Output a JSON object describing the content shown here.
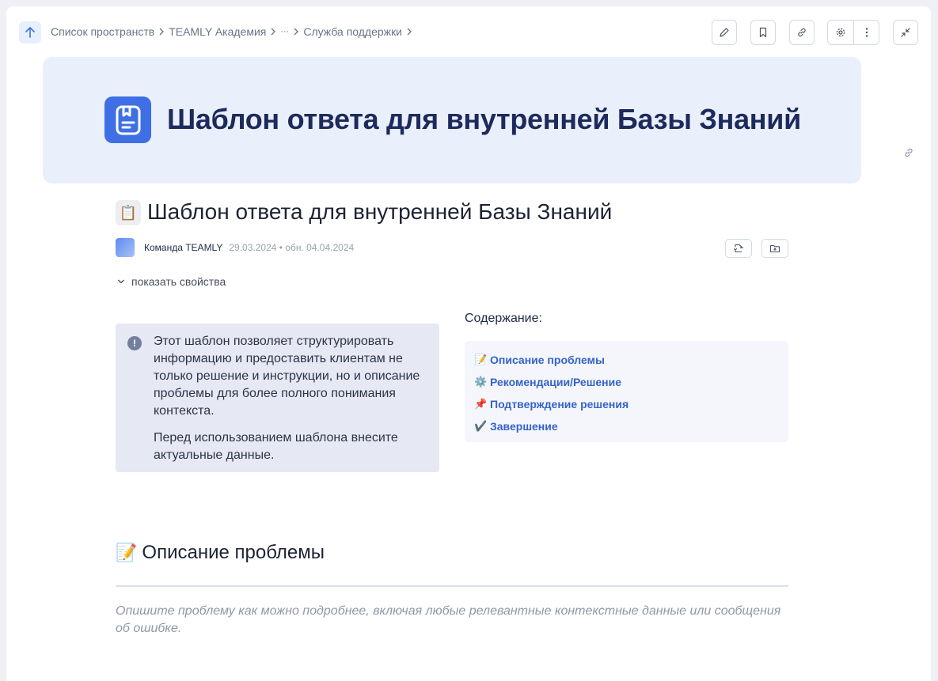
{
  "breadcrumb": {
    "items": [
      "Список пространств",
      "TEAMLY Академия",
      "···",
      "Служба поддержки"
    ]
  },
  "toolbar": {
    "buttons": [
      "pencil-icon",
      "bookmark-icon",
      "link-icon",
      "gear-icon",
      "more-vertical-icon",
      "collapse-icon"
    ]
  },
  "banner": {
    "title": "Шаблон ответа для внутренней Базы Знаний"
  },
  "article": {
    "emoji": "📋",
    "title": "Шаблон ответа для внутренней Базы Знаний",
    "author": "Команда TEAMLY",
    "dates": "29.03.2024 • обн. 04.04.2024",
    "show_properties": "показать свойства"
  },
  "info_panel": {
    "paragraph1": "Этот шаблон позволяет структурировать информацию и предоставить клиентам не только решение и инструкции, но и описание проблемы для более полного понимания контекста.",
    "paragraph2": "Перед использованием шаблона внесите актуальные данные."
  },
  "contents": {
    "heading": "Содержание:",
    "items": [
      {
        "emoji": "📝",
        "label": "Описание проблемы"
      },
      {
        "emoji": "⚙️",
        "label": "Рекомендации/Решение"
      },
      {
        "emoji": "📌",
        "label": "Подтверждение решения"
      },
      {
        "emoji": "✔️",
        "label": "Завершение"
      }
    ]
  },
  "section": {
    "emoji": "📝",
    "title": "Описание проблемы",
    "hint": "Опишите проблему как можно подробнее, включая любые релевантные контекстные данные или сообщения об ошибке."
  },
  "colors": {
    "accent": "#3f6fe4",
    "banner_bg": "#e9effb",
    "info_bg": "#e6e9f4",
    "link": "#3563c9"
  }
}
